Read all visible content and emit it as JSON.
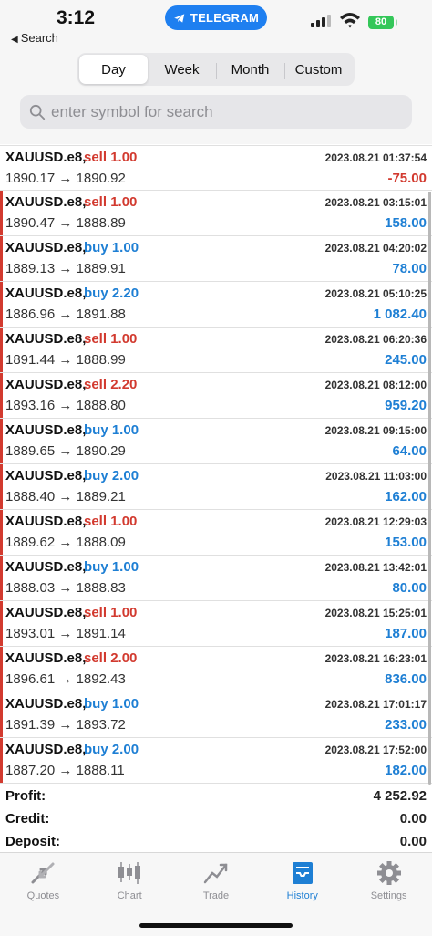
{
  "status_bar": {
    "time": "3:12",
    "back_label": "Search",
    "pill_label": "TELEGRAM",
    "battery": "80"
  },
  "period_tabs": [
    {
      "label": "Day",
      "active": true
    },
    {
      "label": "Week",
      "active": false
    },
    {
      "label": "Month",
      "active": false
    },
    {
      "label": "Custom",
      "active": false
    }
  ],
  "search": {
    "placeholder": "enter symbol for search",
    "value": ""
  },
  "trades": [
    {
      "symbol": "XAUUSD.e8",
      "side": "sell",
      "volume": "1.00",
      "open": "1890.17",
      "close": "1890.92",
      "time": "2023.08.21 01:37:54",
      "profit": "-75.00"
    },
    {
      "symbol": "XAUUSD.e8",
      "side": "sell",
      "volume": "1.00",
      "open": "1890.47",
      "close": "1888.89",
      "time": "2023.08.21 03:15:01",
      "profit": "158.00"
    },
    {
      "symbol": "XAUUSD.e8",
      "side": "buy",
      "volume": "1.00",
      "open": "1889.13",
      "close": "1889.91",
      "time": "2023.08.21 04:20:02",
      "profit": "78.00"
    },
    {
      "symbol": "XAUUSD.e8",
      "side": "buy",
      "volume": "2.20",
      "open": "1886.96",
      "close": "1891.88",
      "time": "2023.08.21 05:10:25",
      "profit": "1 082.40"
    },
    {
      "symbol": "XAUUSD.e8",
      "side": "sell",
      "volume": "1.00",
      "open": "1891.44",
      "close": "1888.99",
      "time": "2023.08.21 06:20:36",
      "profit": "245.00"
    },
    {
      "symbol": "XAUUSD.e8",
      "side": "sell",
      "volume": "2.20",
      "open": "1893.16",
      "close": "1888.80",
      "time": "2023.08.21 08:12:00",
      "profit": "959.20"
    },
    {
      "symbol": "XAUUSD.e8",
      "side": "buy",
      "volume": "1.00",
      "open": "1889.65",
      "close": "1890.29",
      "time": "2023.08.21 09:15:00",
      "profit": "64.00"
    },
    {
      "symbol": "XAUUSD.e8",
      "side": "buy",
      "volume": "2.00",
      "open": "1888.40",
      "close": "1889.21",
      "time": "2023.08.21 11:03:00",
      "profit": "162.00"
    },
    {
      "symbol": "XAUUSD.e8",
      "side": "sell",
      "volume": "1.00",
      "open": "1889.62",
      "close": "1888.09",
      "time": "2023.08.21 12:29:03",
      "profit": "153.00"
    },
    {
      "symbol": "XAUUSD.e8",
      "side": "buy",
      "volume": "1.00",
      "open": "1888.03",
      "close": "1888.83",
      "time": "2023.08.21 13:42:01",
      "profit": "80.00"
    },
    {
      "symbol": "XAUUSD.e8",
      "side": "sell",
      "volume": "1.00",
      "open": "1893.01",
      "close": "1891.14",
      "time": "2023.08.21 15:25:01",
      "profit": "187.00"
    },
    {
      "symbol": "XAUUSD.e8",
      "side": "sell",
      "volume": "2.00",
      "open": "1896.61",
      "close": "1892.43",
      "time": "2023.08.21 16:23:01",
      "profit": "836.00"
    },
    {
      "symbol": "XAUUSD.e8",
      "side": "buy",
      "volume": "1.00",
      "open": "1891.39",
      "close": "1893.72",
      "time": "2023.08.21 17:01:17",
      "profit": "233.00"
    },
    {
      "symbol": "XAUUSD.e8",
      "side": "buy",
      "volume": "2.00",
      "open": "1887.20",
      "close": "1888.11",
      "time": "2023.08.21 17:52:00",
      "profit": "182.00"
    }
  ],
  "summary": [
    {
      "label": "Profit:",
      "value": "4 252.92"
    },
    {
      "label": "Credit:",
      "value": "0.00"
    },
    {
      "label": "Deposit:",
      "value": "0.00"
    }
  ],
  "tab_bar": [
    {
      "label": "Quotes",
      "icon": "quotes-icon",
      "active": false
    },
    {
      "label": "Chart",
      "icon": "chart-icon",
      "active": false
    },
    {
      "label": "Trade",
      "icon": "trade-icon",
      "active": false
    },
    {
      "label": "History",
      "icon": "history-icon",
      "active": true
    },
    {
      "label": "Settings",
      "icon": "gear-icon",
      "active": false
    }
  ],
  "colors": {
    "sell": "#d23a2f",
    "buy": "#1e7fd4",
    "accent": "#1e7fd4",
    "telegram": "#1e7ff0",
    "battery": "#34c759"
  }
}
